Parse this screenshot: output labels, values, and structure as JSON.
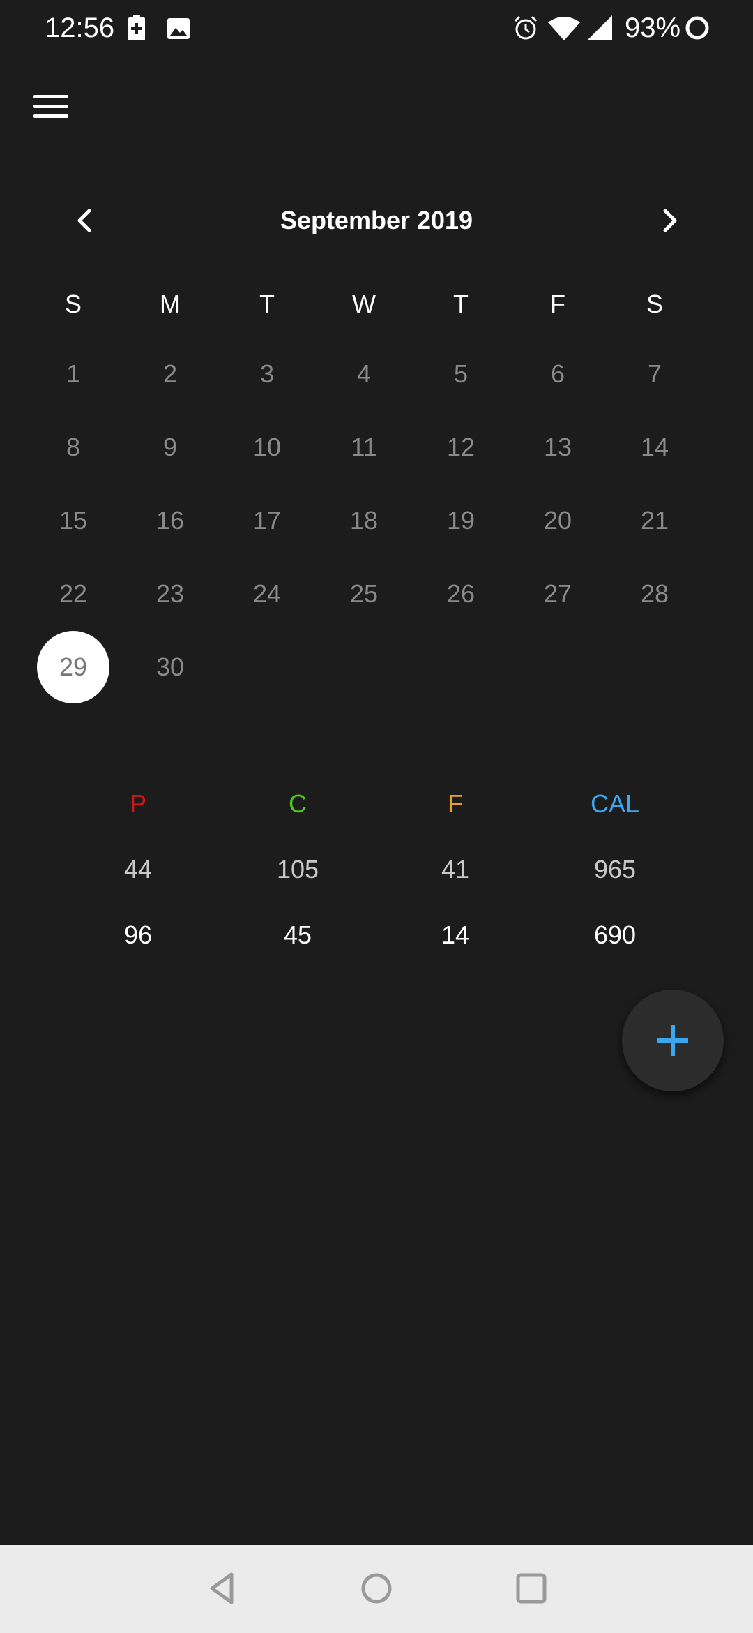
{
  "status_bar": {
    "time": "12:56",
    "battery_percent": "93%",
    "icons": [
      "battery-saver-icon",
      "image-icon",
      "alarm-icon",
      "wifi-icon",
      "signal-icon",
      "battery-ring-icon"
    ]
  },
  "header": {
    "menu_icon": "hamburger-menu-icon"
  },
  "calendar": {
    "month_title": "September 2019",
    "prev_icon": "chevron-left-icon",
    "next_icon": "chevron-right-icon",
    "weekdays": [
      "S",
      "M",
      "T",
      "W",
      "T",
      "F",
      "S"
    ],
    "weeks": [
      [
        "1",
        "2",
        "3",
        "4",
        "5",
        "6",
        "7"
      ],
      [
        "8",
        "9",
        "10",
        "11",
        "12",
        "13",
        "14"
      ],
      [
        "15",
        "16",
        "17",
        "18",
        "19",
        "20",
        "21"
      ],
      [
        "22",
        "23",
        "24",
        "25",
        "26",
        "27",
        "28"
      ],
      [
        "29",
        "30"
      ]
    ],
    "selected_day": "29"
  },
  "macros": {
    "headers": [
      {
        "label": "P",
        "color": "#d0161a"
      },
      {
        "label": "C",
        "color": "#4cc619"
      },
      {
        "label": "F",
        "color": "#e8a21c"
      },
      {
        "label": "CAL",
        "color": "#3aa7ee"
      }
    ],
    "row1": [
      "44",
      "105",
      "41",
      "965"
    ],
    "row2": [
      "96",
      "45",
      "14",
      "690"
    ]
  },
  "fab": {
    "icon": "plus-icon",
    "color": "#3aa7ee"
  },
  "nav_bar": {
    "icons": [
      "back-icon",
      "home-icon",
      "recents-icon"
    ]
  }
}
